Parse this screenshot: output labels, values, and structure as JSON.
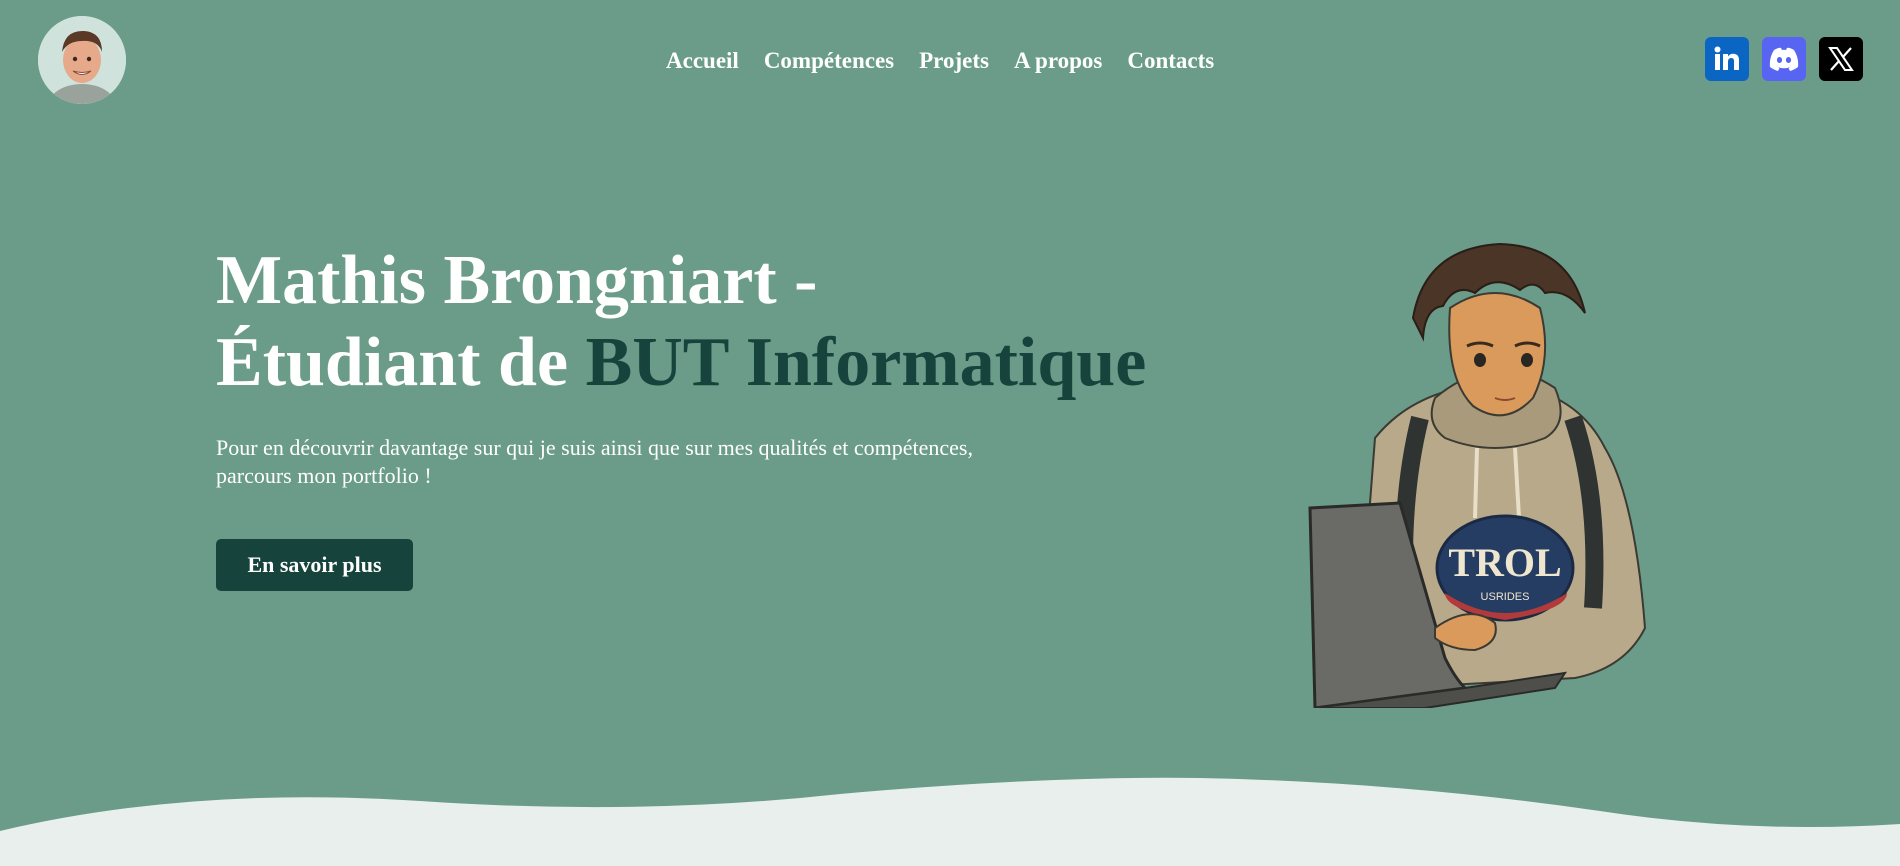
{
  "header": {
    "avatar_alt": "Mathis avatar",
    "nav": [
      "Accueil",
      "Compétences",
      "Projets",
      "A propos",
      "Contacts"
    ],
    "socials": [
      {
        "name": "linkedin-icon",
        "color": "#0a66c2"
      },
      {
        "name": "discord-icon",
        "color": "#5865f2"
      },
      {
        "name": "x-icon",
        "color": "#000000"
      }
    ]
  },
  "hero": {
    "title_line1": "Mathis Brongniart -",
    "title_line2_prefix": "Étudiant de ",
    "title_line2_accent": "BUT Informatique",
    "desc_line1": "Pour en découvrir davantage sur qui je suis ainsi que sur mes qualités et compétences,",
    "desc_line2": "parcours mon portfolio !",
    "cta_label": "En savoir plus"
  },
  "colors": {
    "background": "#6a9c89",
    "accent": "#16433c",
    "wave": "#e8efec"
  }
}
